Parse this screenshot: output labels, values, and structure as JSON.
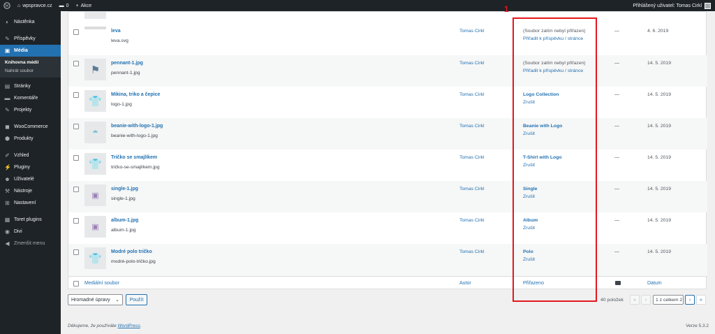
{
  "adminbar": {
    "site_name": "wpspravce.cz",
    "comments_count": "0",
    "new_label": "Akce",
    "user_greeting": "Přihlášený uživatel: Tomas Cirkl"
  },
  "sidebar": {
    "items": [
      {
        "label": "Nástěnka",
        "icon": "dashboard-icon"
      },
      {
        "label": "Příspěvky",
        "icon": "pin-icon"
      },
      {
        "label": "Média",
        "icon": "media-icon"
      },
      {
        "label": "Stránky",
        "icon": "page-icon"
      },
      {
        "label": "Komentáře",
        "icon": "comment-icon"
      },
      {
        "label": "Projekty",
        "icon": "pin-icon"
      },
      {
        "label": "WooCommerce",
        "icon": "woo-icon"
      },
      {
        "label": "Produkty",
        "icon": "box-icon"
      },
      {
        "label": "Vzhled",
        "icon": "brush-icon"
      },
      {
        "label": "Pluginy",
        "icon": "plug-icon"
      },
      {
        "label": "Uživatelé",
        "icon": "users-icon"
      },
      {
        "label": "Nástroje",
        "icon": "wrench-icon"
      },
      {
        "label": "Nastavení",
        "icon": "settings-icon"
      },
      {
        "label": "Toret plugins",
        "icon": "plugin-icon"
      },
      {
        "label": "Divi",
        "icon": "divi-icon"
      },
      {
        "label": "Zmenšit menu",
        "icon": "collapse-icon"
      }
    ],
    "submenu": [
      "Knihovna médií",
      "Nahrát soubor"
    ]
  },
  "rows": [
    {
      "title": "leva",
      "file": "leva.svg",
      "author": "Tomas Cirkl",
      "att1": "(Soubor zatím nebyl přiřazen)",
      "att2": "Přiřadit k příspěvku / stránce",
      "comments": "—",
      "date": "4. 6. 2019"
    },
    {
      "title": "pennant-1.jpg",
      "file": "pennant-1.jpg",
      "author": "Tomas Cirkl",
      "att1": "(Soubor zatím nebyl přiřazen)",
      "att2": "Přiřadit k příspěvku / stránce",
      "comments": "—",
      "date": "14. 5. 2019"
    },
    {
      "title": "Mikina, triko a čepice",
      "file": "logo-1.jpg",
      "author": "Tomas Cirkl",
      "att1": "Logo Collection",
      "att2": "Zrušit",
      "comments": "—",
      "date": "14. 5. 2019"
    },
    {
      "title": "beanie-with-logo-1.jpg",
      "file": "beanie-with-logo-1.jpg",
      "author": "Tomas Cirkl",
      "att1": "Beanie with Logo",
      "att2": "Zrušit",
      "comments": "—",
      "date": "14. 5. 2019"
    },
    {
      "title": "Tričko se smajlíkem",
      "file": "tričko-se-smajlíkem.jpg",
      "author": "Tomas Cirkl",
      "att1": "T-Shirt with Logo",
      "att2": "Zrušit",
      "comments": "—",
      "date": "14. 5. 2019"
    },
    {
      "title": "single-1.jpg",
      "file": "single-1.jpg",
      "author": "Tomas Cirkl",
      "att1": "Single",
      "att2": "Zrušit",
      "comments": "—",
      "date": "14. 5. 2019"
    },
    {
      "title": "album-1.jpg",
      "file": "album-1.jpg",
      "author": "Tomas Cirkl",
      "att1": "Album",
      "att2": "Zrušit",
      "comments": "—",
      "date": "14. 5. 2019"
    },
    {
      "title": "Modré polo tričko",
      "file": "modré-polo-tričko.jpg",
      "author": "Tomas Cirkl",
      "att1": "Polo",
      "att2": "Zrušit",
      "comments": "—",
      "date": "14. 5. 2019"
    }
  ],
  "footer_columns": {
    "file": "Mediální soubor",
    "author": "Autor",
    "attached": "Přiřazeno",
    "date": "Datum"
  },
  "bulk": {
    "selected": "Hromadné úpravy",
    "apply": "Použít"
  },
  "pagination": {
    "count": "40 položek",
    "current_page": "1",
    "total": "z celkem 2",
    "first": "«",
    "prev": "‹",
    "next": "›",
    "last": "»"
  },
  "footer": {
    "thanks_prefix": "Děkujeme, že používáte",
    "wp_link": "WordPress",
    "version": "Verze 5.3.2"
  },
  "annotation": {
    "number": "1",
    "color": "#e3161c"
  },
  "colors": {
    "accent": "#2271b1",
    "sidebar_bg": "#1d2327"
  }
}
